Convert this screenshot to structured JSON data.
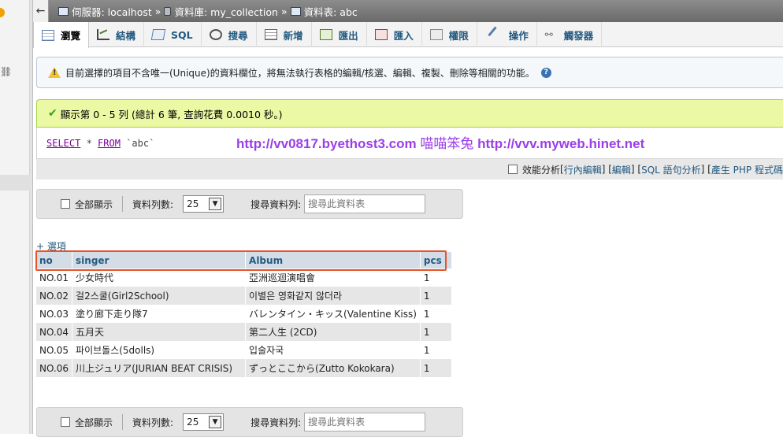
{
  "breadcrumb": {
    "server": "伺服器: localhost",
    "database": "資料庫: my_collection",
    "table": "資料表: abc",
    "separator": "»"
  },
  "tabs": [
    {
      "label": "瀏覽",
      "icon": "browse-icon"
    },
    {
      "label": "結構",
      "icon": "structure-icon"
    },
    {
      "label": "SQL",
      "icon": "sql-icon"
    },
    {
      "label": "搜尋",
      "icon": "search-icon"
    },
    {
      "label": "新增",
      "icon": "insert-icon"
    },
    {
      "label": "匯出",
      "icon": "export-icon"
    },
    {
      "label": "匯入",
      "icon": "import-icon"
    },
    {
      "label": "權限",
      "icon": "privileges-icon"
    },
    {
      "label": "操作",
      "icon": "operations-icon"
    },
    {
      "label": "觸發器",
      "icon": "triggers-icon"
    }
  ],
  "notice": {
    "text": "目前選擇的項目不含唯一(Unique)的資料欄位，將無法執行表格的編輯/核選、編輯、複製、刪除等相關的功能。"
  },
  "success": {
    "text": "顯示第 0 - 5 列 (總計 6 筆, 查詢花費 0.0010 秒。)"
  },
  "sql": {
    "kw1": "SELECT",
    "rest1": " * ",
    "kw2": "FROM",
    "rest2": " `abc`"
  },
  "overlay": {
    "url1": "http://vv0817.byethost3.com",
    "name": " 喵喵笨兔 ",
    "url2": "http://vvv.myweb.hinet.net"
  },
  "linkbar": {
    "profiling": "效能分析",
    "open1": " [ ",
    "inline_edit": "行內編輯",
    "mid1": " ] [ ",
    "edit": "編輯",
    "mid2": " ] [ ",
    "explain": "SQL 語句分析",
    "mid3": " ] [ ",
    "create": "產生 PHP 程式碼"
  },
  "nav": {
    "show_all": "全部顯示",
    "rows_label": "資料列數:",
    "rows_value": "25",
    "filter_label": "搜尋資料列:",
    "filter_value": "搜尋此資料表"
  },
  "options_link": "+ 選項",
  "table": {
    "columns": [
      "no",
      "singer",
      "Album",
      "pcs"
    ],
    "rows": [
      [
        "NO.01",
        "少女時代",
        "亞洲巡迴演唱會",
        "1"
      ],
      [
        "NO.02",
        "걸2스쿨(Girl2School)",
        "이별은 영화같지 않더라",
        "1"
      ],
      [
        "NO.03",
        "塗り廊下走り隊7",
        "バレンタイン・キッス(Valentine Kiss)",
        "1"
      ],
      [
        "NO.04",
        "五月天",
        "第二人生 (2CD)",
        "1"
      ],
      [
        "NO.05",
        "파이브돌스(5dolls)",
        "입술자국",
        "1"
      ],
      [
        "NO.06",
        "川上ジュリア(JURIAN BEAT CRISIS)",
        "ずっとここから(Zutto Kokokara)",
        "1"
      ]
    ]
  }
}
